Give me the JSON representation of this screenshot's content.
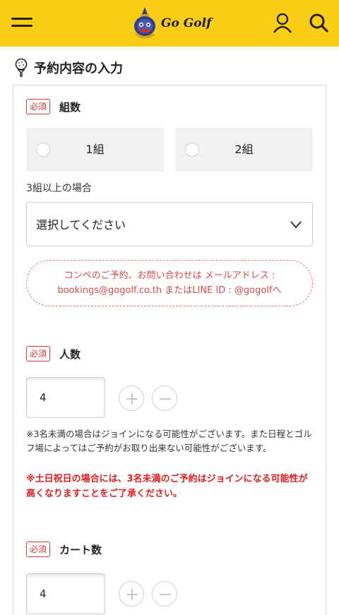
{
  "header": {
    "logo_text": "Go Golf",
    "icons": {
      "menu": "menu-icon",
      "user": "user-icon",
      "search": "search-icon"
    },
    "bg_color": "#f9cd14"
  },
  "section": {
    "title": "予約内容の入力",
    "icon": "golf-ball-tee-icon"
  },
  "required_badge": "必須",
  "groups": {
    "label": "組数",
    "options": [
      {
        "label": "1組",
        "selected": false
      },
      {
        "label": "2組",
        "selected": false
      }
    ],
    "more_label": "3組以上の場合",
    "select_value": "選択してください"
  },
  "notice": {
    "line1": "コンペのご予約、お問い合わせは メールアドレス :",
    "line2": "bookings@gogolf.co.th またはLINE ID : @gogolfへ"
  },
  "people": {
    "label": "人数",
    "value": "4",
    "note": "※3名未満の場合はジョインになる可能性がございます。また日程とゴルフ場によってはご予約がお取り出来ない可能性がございます。",
    "warning": "※土日祝日の場合には、3名未満のご予約はジョインになる可能性が高くなりますことをご了承ください。"
  },
  "carts": {
    "label": "カート数",
    "value": "4"
  },
  "colors": {
    "accent": "#f9cd14",
    "required": "#d23a3a",
    "warning": "#e02020"
  }
}
